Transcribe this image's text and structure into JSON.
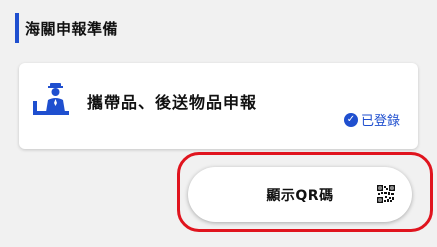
{
  "section": {
    "title": "海關申報準備"
  },
  "card": {
    "title": "攜帶品、後送物品申報",
    "icon": "customs-officer-icon",
    "status_label": "已登錄",
    "status_icon": "check-circle-icon"
  },
  "qr_button": {
    "label": "顯示QR碼",
    "icon": "qr-code-icon"
  },
  "colors": {
    "accent": "#1f4fcf",
    "highlight": "#e0141e",
    "background": "#f1f1f1"
  }
}
